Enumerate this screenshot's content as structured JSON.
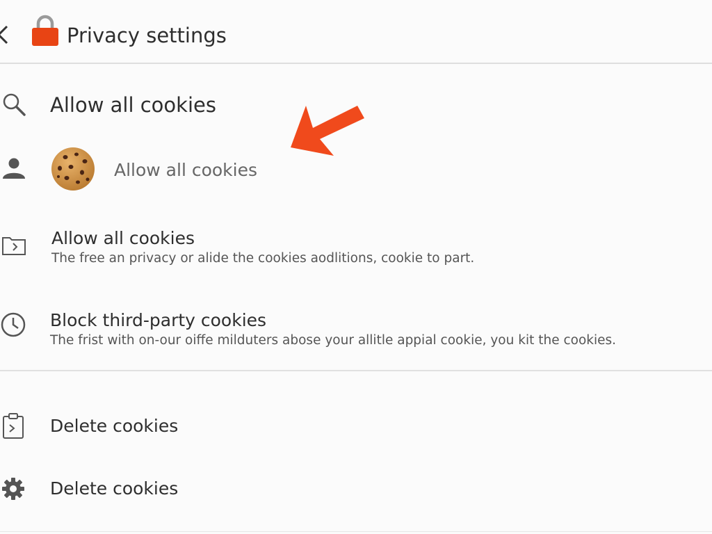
{
  "header": {
    "title": "Privacy settings",
    "back_icon": "chevron-left-icon",
    "lock_icon": "lock-icon",
    "lock_color": "#e84414"
  },
  "options": [
    {
      "label": "Allow all cookies",
      "icon": "search-icon"
    },
    {
      "label": "Allow all cookies",
      "icon": "person-icon",
      "thumbnail": "cookie-icon"
    },
    {
      "label": "Allow all cookies",
      "description": "The free an privacy or alide the cookies aodlitions, cookie to part.",
      "icon": "folder-arrow-icon"
    },
    {
      "label": "Block third-party cookies",
      "description": "The frist with on-our oiffe milduters abose your allitle appial cookie, you  kit the cookies.",
      "icon": "clock-icon"
    }
  ],
  "actions": [
    {
      "label": "Delete cookies",
      "icon": "clipboard-arrow-icon"
    },
    {
      "label": "Delete cookies",
      "icon": "gear-icon"
    }
  ],
  "annotation": {
    "icon": "arrow-pointer-icon",
    "color": "#f04a1c"
  }
}
